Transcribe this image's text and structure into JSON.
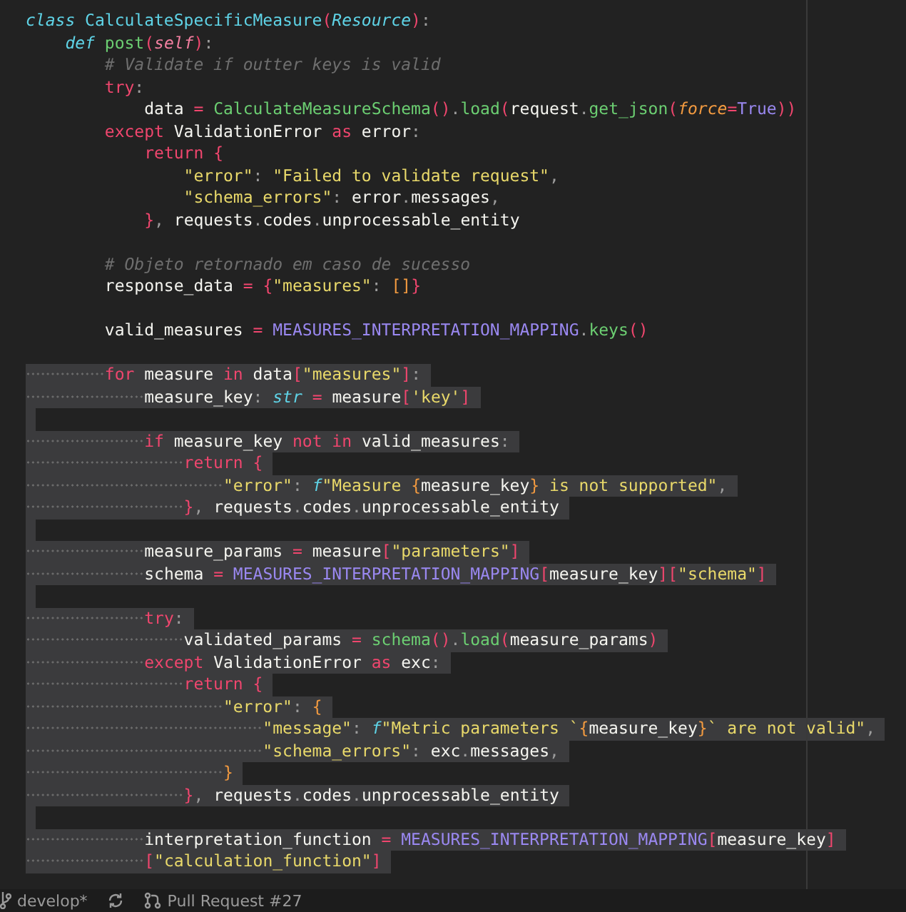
{
  "editor": {
    "lines": [
      {
        "selected": false,
        "tokens": [
          {
            "kind": "decl",
            "text": "class "
          },
          {
            "kind": "type",
            "text": "CalculateSpecificMeasure"
          },
          {
            "kind": "punc",
            "text": "("
          },
          {
            "kind": "inherit",
            "text": "Resource"
          },
          {
            "kind": "punc",
            "text": ")"
          },
          {
            "kind": "sep",
            "text": ":"
          }
        ]
      },
      {
        "selected": false,
        "tokens": [
          {
            "kind": "decl",
            "text": "    def "
          },
          {
            "kind": "fn",
            "text": "post"
          },
          {
            "kind": "punc",
            "text": "("
          },
          {
            "kind": "param",
            "text": "self"
          },
          {
            "kind": "punc",
            "text": ")"
          },
          {
            "kind": "sep",
            "text": ":"
          }
        ]
      },
      {
        "selected": false,
        "tokens": [
          {
            "kind": "cmt",
            "text": "        # Validate if outter keys is valid"
          }
        ]
      },
      {
        "selected": false,
        "tokens": [
          {
            "kind": "kw",
            "text": "        try"
          },
          {
            "kind": "sep",
            "text": ":"
          }
        ]
      },
      {
        "selected": false,
        "tokens": [
          {
            "kind": "text",
            "text": "            data "
          },
          {
            "kind": "kw",
            "text": "= "
          },
          {
            "kind": "fn",
            "text": "CalculateMeasureSchema"
          },
          {
            "kind": "punc",
            "text": "()"
          },
          {
            "kind": "sep",
            "text": "."
          },
          {
            "kind": "fn",
            "text": "load"
          },
          {
            "kind": "punc",
            "text": "("
          },
          {
            "kind": "text",
            "text": "request"
          },
          {
            "kind": "sep",
            "text": "."
          },
          {
            "kind": "fn",
            "text": "get_json"
          },
          {
            "kind": "punc",
            "text": "("
          },
          {
            "kind": "argname",
            "text": "force"
          },
          {
            "kind": "kw",
            "text": "="
          },
          {
            "kind": "const",
            "text": "True"
          },
          {
            "kind": "punc",
            "text": "))"
          }
        ]
      },
      {
        "selected": false,
        "tokens": [
          {
            "kind": "kw",
            "text": "        except"
          },
          {
            "kind": "text",
            "text": " ValidationError "
          },
          {
            "kind": "kw",
            "text": "as"
          },
          {
            "kind": "text",
            "text": " error"
          },
          {
            "kind": "sep",
            "text": ":"
          }
        ]
      },
      {
        "selected": false,
        "tokens": [
          {
            "kind": "kw",
            "text": "            return "
          },
          {
            "kind": "punc",
            "text": "{"
          }
        ]
      },
      {
        "selected": false,
        "tokens": [
          {
            "kind": "str",
            "text": "                \"error\""
          },
          {
            "kind": "sep",
            "text": ": "
          },
          {
            "kind": "str",
            "text": "\"Failed to validate request\""
          },
          {
            "kind": "sep",
            "text": ","
          }
        ]
      },
      {
        "selected": false,
        "tokens": [
          {
            "kind": "str",
            "text": "                \"schema_errors\""
          },
          {
            "kind": "sep",
            "text": ": "
          },
          {
            "kind": "text",
            "text": "error"
          },
          {
            "kind": "sep",
            "text": "."
          },
          {
            "kind": "text",
            "text": "messages"
          },
          {
            "kind": "sep",
            "text": ","
          }
        ]
      },
      {
        "selected": false,
        "tokens": [
          {
            "kind": "punc",
            "text": "            }"
          },
          {
            "kind": "sep",
            "text": ", "
          },
          {
            "kind": "text",
            "text": "requests"
          },
          {
            "kind": "sep",
            "text": "."
          },
          {
            "kind": "text",
            "text": "codes"
          },
          {
            "kind": "sep",
            "text": "."
          },
          {
            "kind": "text",
            "text": "unprocessable_entity"
          }
        ]
      },
      {
        "selected": false
      },
      {
        "selected": false,
        "tokens": [
          {
            "kind": "cmt",
            "text": "        # Objeto retornado em caso de sucesso"
          }
        ]
      },
      {
        "selected": false,
        "tokens": [
          {
            "kind": "text",
            "text": "        response_data "
          },
          {
            "kind": "kw",
            "text": "= "
          },
          {
            "kind": "punc",
            "text": "{"
          },
          {
            "kind": "str",
            "text": "\"measures\""
          },
          {
            "kind": "sep",
            "text": ": "
          },
          {
            "kind": "brace",
            "text": "[]"
          },
          {
            "kind": "punc",
            "text": "}"
          }
        ]
      },
      {
        "selected": false
      },
      {
        "selected": false,
        "tokens": [
          {
            "kind": "text",
            "text": "        valid_measures "
          },
          {
            "kind": "kw",
            "text": "= "
          },
          {
            "kind": "const",
            "text": "MEASURES_INTERPRETATION_MAPPING"
          },
          {
            "kind": "sep",
            "text": "."
          },
          {
            "kind": "fn",
            "text": "keys"
          },
          {
            "kind": "punc",
            "text": "()"
          }
        ]
      },
      {
        "selected": false
      },
      {
        "selected": true,
        "tokens": [
          {
            "kind": "kw",
            "text": "        for"
          },
          {
            "kind": "text",
            "text": " measure "
          },
          {
            "kind": "kw",
            "text": "in"
          },
          {
            "kind": "text",
            "text": " data"
          },
          {
            "kind": "punc",
            "text": "["
          },
          {
            "kind": "str",
            "text": "\"measures\""
          },
          {
            "kind": "punc",
            "text": "]"
          },
          {
            "kind": "sep",
            "text": ":"
          }
        ]
      },
      {
        "selected": true,
        "tokens": [
          {
            "kind": "text",
            "text": "            measure_key"
          },
          {
            "kind": "sep",
            "text": ": "
          },
          {
            "kind": "decl",
            "text": "str "
          },
          {
            "kind": "kw",
            "text": "="
          },
          {
            "kind": "text",
            "text": " measure"
          },
          {
            "kind": "punc",
            "text": "["
          },
          {
            "kind": "str",
            "text": "'key'"
          },
          {
            "kind": "punc",
            "text": "]"
          }
        ]
      },
      {
        "selected": true
      },
      {
        "selected": true,
        "tokens": [
          {
            "kind": "kw",
            "text": "            if"
          },
          {
            "kind": "text",
            "text": " measure_key "
          },
          {
            "kind": "kw",
            "text": "not in"
          },
          {
            "kind": "text",
            "text": " valid_measures"
          },
          {
            "kind": "sep",
            "text": ":"
          }
        ]
      },
      {
        "selected": true,
        "tokens": [
          {
            "kind": "kw",
            "text": "                return "
          },
          {
            "kind": "punc",
            "text": "{"
          }
        ]
      },
      {
        "selected": true,
        "tokens": [
          {
            "kind": "str",
            "text": "                    \"error\""
          },
          {
            "kind": "sep",
            "text": ": "
          },
          {
            "kind": "decl",
            "text": "f"
          },
          {
            "kind": "str",
            "text": "\"Measure "
          },
          {
            "kind": "brace",
            "text": "{"
          },
          {
            "kind": "text",
            "text": "measure_key"
          },
          {
            "kind": "brace",
            "text": "}"
          },
          {
            "kind": "str",
            "text": " is not supported\""
          },
          {
            "kind": "sep",
            "text": ","
          }
        ]
      },
      {
        "selected": true,
        "tokens": [
          {
            "kind": "punc",
            "text": "                }"
          },
          {
            "kind": "sep",
            "text": ", "
          },
          {
            "kind": "text",
            "text": "requests"
          },
          {
            "kind": "sep",
            "text": "."
          },
          {
            "kind": "text",
            "text": "codes"
          },
          {
            "kind": "sep",
            "text": "."
          },
          {
            "kind": "text",
            "text": "unprocessable_entity"
          }
        ]
      },
      {
        "selected": true
      },
      {
        "selected": true,
        "tokens": [
          {
            "kind": "text",
            "text": "            measure_params "
          },
          {
            "kind": "kw",
            "text": "="
          },
          {
            "kind": "text",
            "text": " measure"
          },
          {
            "kind": "punc",
            "text": "["
          },
          {
            "kind": "str",
            "text": "\"parameters\""
          },
          {
            "kind": "punc",
            "text": "]"
          }
        ]
      },
      {
        "selected": true,
        "tokens": [
          {
            "kind": "text",
            "text": "            schema "
          },
          {
            "kind": "kw",
            "text": "= "
          },
          {
            "kind": "const",
            "text": "MEASURES_INTERPRETATION_MAPPING"
          },
          {
            "kind": "punc",
            "text": "["
          },
          {
            "kind": "text",
            "text": "measure_key"
          },
          {
            "kind": "punc",
            "text": "]["
          },
          {
            "kind": "str",
            "text": "\"schema\""
          },
          {
            "kind": "punc",
            "text": "]"
          }
        ]
      },
      {
        "selected": true
      },
      {
        "selected": true,
        "tokens": [
          {
            "kind": "kw",
            "text": "            try"
          },
          {
            "kind": "sep",
            "text": ":"
          }
        ]
      },
      {
        "selected": true,
        "tokens": [
          {
            "kind": "text",
            "text": "                validated_params "
          },
          {
            "kind": "kw",
            "text": "= "
          },
          {
            "kind": "fn",
            "text": "schema"
          },
          {
            "kind": "punc",
            "text": "()"
          },
          {
            "kind": "sep",
            "text": "."
          },
          {
            "kind": "fn",
            "text": "load"
          },
          {
            "kind": "punc",
            "text": "("
          },
          {
            "kind": "text",
            "text": "measure_params"
          },
          {
            "kind": "punc",
            "text": ")"
          }
        ]
      },
      {
        "selected": true,
        "tokens": [
          {
            "kind": "kw",
            "text": "            except"
          },
          {
            "kind": "text",
            "text": " ValidationError "
          },
          {
            "kind": "kw",
            "text": "as"
          },
          {
            "kind": "text",
            "text": " exc"
          },
          {
            "kind": "sep",
            "text": ":"
          }
        ]
      },
      {
        "selected": true,
        "tokens": [
          {
            "kind": "kw",
            "text": "                return "
          },
          {
            "kind": "punc",
            "text": "{"
          }
        ]
      },
      {
        "selected": true,
        "tokens": [
          {
            "kind": "str",
            "text": "                    \"error\""
          },
          {
            "kind": "sep",
            "text": ": "
          },
          {
            "kind": "brace",
            "text": "{"
          }
        ]
      },
      {
        "selected": true,
        "tokens": [
          {
            "kind": "str",
            "text": "                        \"message\""
          },
          {
            "kind": "sep",
            "text": ": "
          },
          {
            "kind": "decl",
            "text": "f"
          },
          {
            "kind": "str",
            "text": "\"Metric parameters `"
          },
          {
            "kind": "brace",
            "text": "{"
          },
          {
            "kind": "text",
            "text": "measure_key"
          },
          {
            "kind": "brace",
            "text": "}"
          },
          {
            "kind": "str",
            "text": "` are not valid\""
          },
          {
            "kind": "sep",
            "text": ","
          }
        ]
      },
      {
        "selected": true,
        "tokens": [
          {
            "kind": "str",
            "text": "                        \"schema_errors\""
          },
          {
            "kind": "sep",
            "text": ": "
          },
          {
            "kind": "text",
            "text": "exc"
          },
          {
            "kind": "sep",
            "text": "."
          },
          {
            "kind": "text",
            "text": "messages"
          },
          {
            "kind": "sep",
            "text": ","
          }
        ]
      },
      {
        "selected": true,
        "tokens": [
          {
            "kind": "brace",
            "text": "                    }"
          }
        ]
      },
      {
        "selected": true,
        "tokens": [
          {
            "kind": "punc",
            "text": "                }"
          },
          {
            "kind": "sep",
            "text": ", "
          },
          {
            "kind": "text",
            "text": "requests"
          },
          {
            "kind": "sep",
            "text": "."
          },
          {
            "kind": "text",
            "text": "codes"
          },
          {
            "kind": "sep",
            "text": "."
          },
          {
            "kind": "text",
            "text": "unprocessable_entity"
          }
        ]
      },
      {
        "selected": true
      },
      {
        "selected": true,
        "tokens": [
          {
            "kind": "text",
            "text": "            interpretation_function "
          },
          {
            "kind": "kw",
            "text": "= "
          },
          {
            "kind": "const",
            "text": "MEASURES_INTERPRETATION_MAPPING"
          },
          {
            "kind": "punc",
            "text": "["
          },
          {
            "kind": "text",
            "text": "measure_key"
          },
          {
            "kind": "punc",
            "text": "]"
          }
        ]
      },
      {
        "selected": true,
        "tokens": [
          {
            "kind": "punc",
            "text": "            ["
          },
          {
            "kind": "str",
            "text": "\"calculation_function\""
          },
          {
            "kind": "punc",
            "text": "]"
          }
        ]
      }
    ]
  },
  "status_bar": {
    "branch": "develop*",
    "pull_request": "Pull Request #27"
  }
}
